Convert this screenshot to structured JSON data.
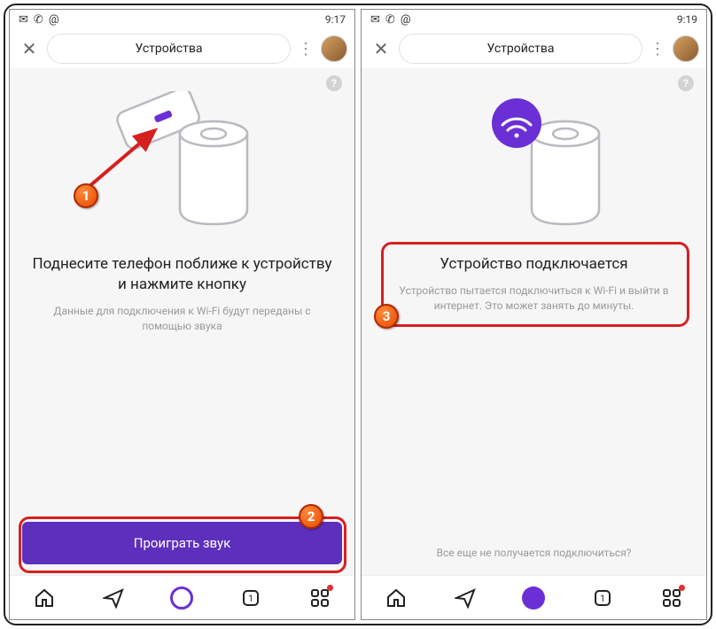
{
  "left": {
    "status": {
      "time": "9:17"
    },
    "header": {
      "title": "Устройства"
    },
    "headline": "Поднесите телефон поближе к устройству и нажмите кнопку",
    "sub": "Данные для подключения к Wi-Fi будут переданы с помощью звука",
    "button": "Проиграть звук"
  },
  "right": {
    "status": {
      "time": "9:19"
    },
    "header": {
      "title": "Устройства"
    },
    "headline": "Устройство подключается",
    "sub": "Устройство пытается подключиться к Wi-Fi и выйти в интернет. Это может занять до минуты.",
    "still": "Все еще не получается подключиться?"
  },
  "markers": {
    "m1": "1",
    "m2": "2",
    "m3": "3"
  }
}
